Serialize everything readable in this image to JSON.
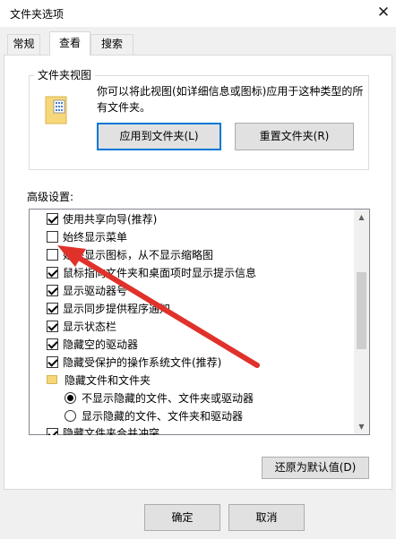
{
  "window": {
    "title": "文件夹选项",
    "close_glyph": "✕"
  },
  "tabs": [
    {
      "label": "常规",
      "active": false
    },
    {
      "label": "查看",
      "active": true
    },
    {
      "label": "搜索",
      "active": false
    }
  ],
  "folder_views": {
    "legend": "文件夹视图",
    "description": "你可以将此视图(如详细信息或图标)应用于这种类型的所有文件夹。",
    "apply_button": "应用到文件夹(L)",
    "reset_button": "重置文件夹(R)"
  },
  "advanced": {
    "label": "高级设置:",
    "items": [
      {
        "type": "checkbox",
        "checked": true,
        "label": "使用共享向导(推荐)"
      },
      {
        "type": "checkbox",
        "checked": false,
        "label": "始终显示菜单"
      },
      {
        "type": "checkbox",
        "checked": false,
        "label": "始终显示图标，从不显示缩略图"
      },
      {
        "type": "checkbox",
        "checked": true,
        "label": "鼠标指向文件夹和桌面项时显示提示信息"
      },
      {
        "type": "checkbox",
        "checked": true,
        "label": "显示驱动器号"
      },
      {
        "type": "checkbox",
        "checked": true,
        "label": "显示同步提供程序通知"
      },
      {
        "type": "checkbox",
        "checked": true,
        "label": "显示状态栏"
      },
      {
        "type": "checkbox",
        "checked": true,
        "label": "隐藏空的驱动器"
      },
      {
        "type": "checkbox",
        "checked": true,
        "label": "隐藏受保护的操作系统文件(推荐)"
      },
      {
        "type": "folder",
        "label": "隐藏文件和文件夹"
      },
      {
        "type": "radio",
        "checked": true,
        "label": "不显示隐藏的文件、文件夹或驱动器"
      },
      {
        "type": "radio",
        "checked": false,
        "label": "显示隐藏的文件、文件夹和驱动器"
      },
      {
        "type": "checkbox",
        "checked": true,
        "label": "隐藏文件夹合并冲突"
      }
    ],
    "restore_button": "还原为默认值(D)"
  },
  "footer": {
    "ok_button": "确定",
    "cancel_button": "取消"
  },
  "annotation": {
    "arrow_color": "#e0312a"
  }
}
